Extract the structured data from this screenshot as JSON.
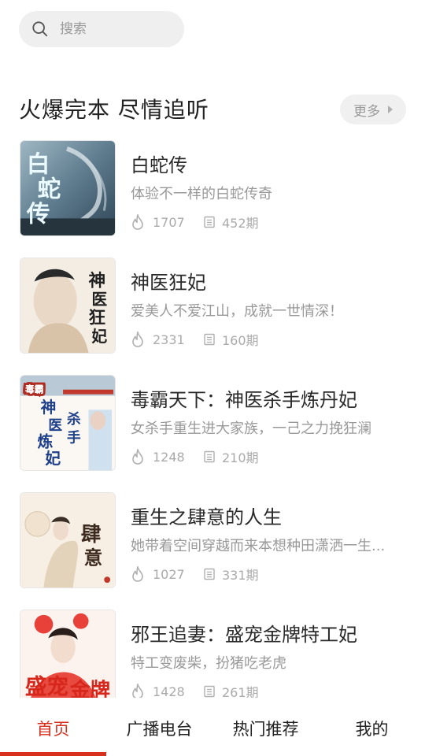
{
  "search": {
    "placeholder": "搜索"
  },
  "section": {
    "title": "火爆完本 尽情追听",
    "more_label": "更多"
  },
  "books": [
    {
      "title": "白蛇传",
      "desc": "体验不一样的白蛇传奇",
      "plays": "1707",
      "episodes": "452期",
      "cover_text": "白蛇传"
    },
    {
      "title": "神医狂妃",
      "desc": "爱美人不爱江山，成就一世情深！",
      "plays": "2331",
      "episodes": "160期",
      "cover_text": "神医狂妃"
    },
    {
      "title": "毒霸天下：神医杀手炼丹妃",
      "desc": "女杀手重生进大家族，一己之力挽狂澜",
      "plays": "1248",
      "episodes": "210期",
      "cover_text": "神医杀手炼丹妃"
    },
    {
      "title": "重生之肆意的人生",
      "desc": "她带着空间穿越而来本想种田潇洒一生...",
      "plays": "1027",
      "episodes": "331期",
      "cover_text": "肆意"
    },
    {
      "title": "邪王追妻：盛宠金牌特工妃",
      "desc": "特工变废柴，扮猪吃老虎",
      "plays": "1428",
      "episodes": "261期",
      "cover_text": "盛宠金牌"
    }
  ],
  "tabs": [
    "首页",
    "广播电台",
    "热门推荐",
    "我的"
  ],
  "colors": {
    "accent": "#d8301f",
    "muted": "#999999"
  },
  "icons": {
    "search": "search-icon",
    "fire": "fire-icon",
    "episodes": "episode-list-icon",
    "more": "triangle-right-icon"
  }
}
